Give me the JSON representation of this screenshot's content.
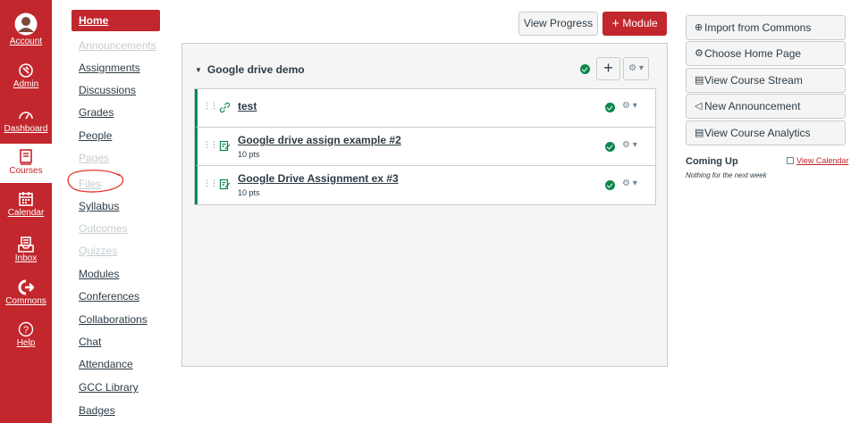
{
  "global_nav": {
    "items": [
      {
        "label": "Account",
        "icon": "account-avatar"
      },
      {
        "label": "Admin",
        "icon": "shield-icon"
      },
      {
        "label": "Dashboard",
        "icon": "dashboard-icon"
      },
      {
        "label": "Courses",
        "icon": "book-icon",
        "active": true
      },
      {
        "label": "Calendar",
        "icon": "calendar-icon"
      },
      {
        "label": "Inbox",
        "icon": "inbox-icon"
      },
      {
        "label": "Commons",
        "icon": "commons-icon"
      },
      {
        "label": "Help",
        "icon": "help-icon"
      }
    ]
  },
  "course_nav": {
    "items": [
      {
        "label": "Home",
        "state": "active"
      },
      {
        "label": "Announcements",
        "state": "hidden"
      },
      {
        "label": "Assignments",
        "state": "visible"
      },
      {
        "label": "Discussions",
        "state": "visible"
      },
      {
        "label": "Grades",
        "state": "visible"
      },
      {
        "label": "People",
        "state": "visible"
      },
      {
        "label": "Pages",
        "state": "hidden"
      },
      {
        "label": "Files",
        "state": "hidden"
      },
      {
        "label": "Syllabus",
        "state": "visible"
      },
      {
        "label": "Outcomes",
        "state": "hidden"
      },
      {
        "label": "Quizzes",
        "state": "hidden"
      },
      {
        "label": "Modules",
        "state": "visible"
      },
      {
        "label": "Conferences",
        "state": "visible"
      },
      {
        "label": "Collaborations",
        "state": "visible"
      },
      {
        "label": "Chat",
        "state": "visible"
      },
      {
        "label": "Attendance",
        "state": "visible"
      },
      {
        "label": "GCC Library",
        "state": "visible"
      },
      {
        "label": "Badges",
        "state": "visible"
      }
    ]
  },
  "header": {
    "view_progress": "View Progress",
    "add_module": "Module",
    "add_module_icon": "+"
  },
  "module": {
    "title": "Google drive demo",
    "items": [
      {
        "title": "test",
        "type": "link",
        "points": ""
      },
      {
        "title": "Google drive assign example #2",
        "type": "assignment",
        "points": "10 pts"
      },
      {
        "title": "Google Drive Assignment ex #3",
        "type": "assignment",
        "points": "10 pts"
      }
    ]
  },
  "sidebar": {
    "buttons": [
      {
        "label": "Import from Commons",
        "icon": "import-icon"
      },
      {
        "label": "Choose Home Page",
        "icon": "home-settings-icon"
      },
      {
        "label": "View Course Stream",
        "icon": "stream-icon"
      },
      {
        "label": "New Announcement",
        "icon": "megaphone-icon"
      },
      {
        "label": "View Course Analytics",
        "icon": "analytics-icon"
      }
    ],
    "coming_up": {
      "title": "Coming Up",
      "view_calendar": "View Calendar",
      "empty": "Nothing for the next week"
    }
  },
  "colors": {
    "brand": "#c2272d",
    "published": "#0b874b",
    "hidden_text": "#c7cdd1",
    "annotation": "#e8342e"
  }
}
